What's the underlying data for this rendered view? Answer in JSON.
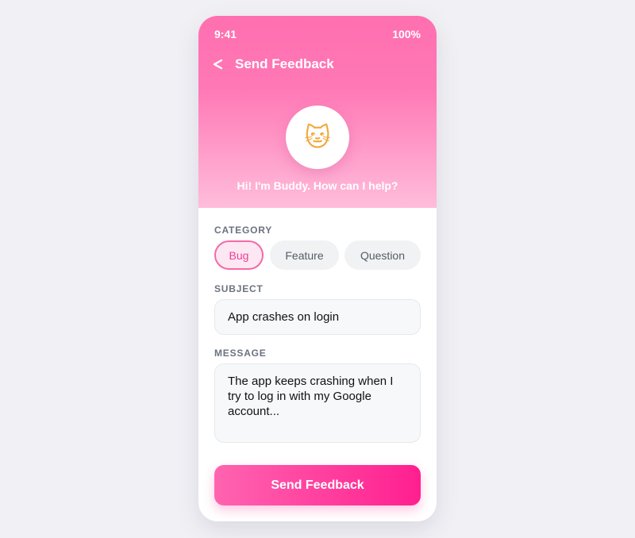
{
  "status_bar": {
    "time": "9:41",
    "battery": "100%"
  },
  "header": {
    "back_icon": "chevron-left-icon",
    "title": "Send Feedback"
  },
  "mascot": {
    "icon": "cat-face-icon",
    "glyph": "🐱",
    "greeting": "Hi! I'm Buddy. How can I help?"
  },
  "category": {
    "label": "CATEGORY",
    "options": [
      "Bug",
      "Feature",
      "Question"
    ],
    "selected": "Bug"
  },
  "subject": {
    "label": "SUBJECT",
    "value": "App crashes on login"
  },
  "message": {
    "label": "MESSAGE",
    "value": "The app keeps crashing when I try to log in with my Google account..."
  },
  "submit": {
    "label": "Send Feedback"
  },
  "colors": {
    "accent": "#ff1f8f",
    "accent_light": "#ff6fb0",
    "chip_selected_bg": "#fde7f2",
    "chip_selected_text": "#ef3d94",
    "label_text": "#6b7280",
    "page_background": "#f1f1f5"
  }
}
